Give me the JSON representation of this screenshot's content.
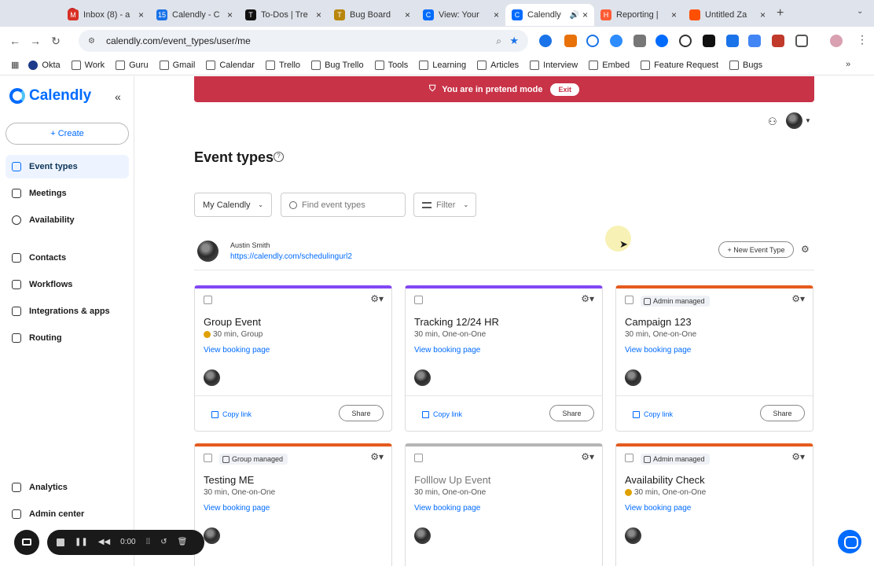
{
  "browser": {
    "tabs": [
      {
        "label": "Inbox (8) - a",
        "fav_color": "#d93025",
        "fav_glyph": "M"
      },
      {
        "label": "Calendly - C",
        "fav_color": "#1a73e8",
        "fav_glyph": "15"
      },
      {
        "label": "To-Dos | Tre",
        "fav_color": "#111111",
        "fav_glyph": "T"
      },
      {
        "label": "Bug Board",
        "fav_color": "#b8860b",
        "fav_glyph": "T"
      },
      {
        "label": "View: Your",
        "fav_color": "#006bff",
        "fav_glyph": "C"
      },
      {
        "label": "Calendly",
        "fav_color": "#006bff",
        "fav_glyph": "C"
      },
      {
        "label": "Reporting |",
        "fav_color": "#ff5c35",
        "fav_glyph": "H"
      },
      {
        "label": "Untitled Za",
        "fav_color": "#ff4f00",
        "fav_glyph": ""
      }
    ],
    "url": "calendly.com/event_types/user/me",
    "bookmarks": [
      "Okta",
      "Work",
      "Guru",
      "Gmail",
      "Calendar",
      "Trello",
      "Bug Trello",
      "Tools",
      "Learning",
      "Articles",
      "Interview",
      "Embed",
      "Feature Request",
      "Bugs"
    ]
  },
  "sidebar": {
    "brand": "Calendly",
    "create": "+ Create",
    "items": [
      "Event types",
      "Meetings",
      "Availability",
      "Contacts",
      "Workflows",
      "Integrations & apps",
      "Routing"
    ],
    "bottom_items": [
      "Analytics",
      "Admin center"
    ]
  },
  "banner": {
    "text": "You are in pretend mode",
    "exit": "Exit"
  },
  "page": {
    "title": "Event types",
    "filter_dropdown": "My Calendly",
    "search_placeholder": "Find event types",
    "filter_label": "Filter",
    "owner_name": "Austin Smith",
    "owner_link": "https://calendly.com/schedulingurl2",
    "new_event_button": "+ New Event Type"
  },
  "cards": [
    {
      "title": "Group Event",
      "meta": "30 min, Group",
      "warn": true,
      "badge": "",
      "color": "#8247f5",
      "link": "View booking page",
      "copy": "Copy link",
      "share": "Share",
      "muted": false
    },
    {
      "title": "Tracking 12/24 HR",
      "meta": "30 min, One-on-One",
      "warn": false,
      "badge": "",
      "color": "#8247f5",
      "link": "View booking page",
      "copy": "Copy link",
      "share": "Share",
      "muted": false
    },
    {
      "title": "Campaign 123",
      "meta": "30 min, One-on-One",
      "warn": false,
      "badge": "Admin managed",
      "color": "#e55b1f",
      "link": "View booking page",
      "copy": "Copy link",
      "share": "Share",
      "muted": false
    },
    {
      "title": "Testing ME",
      "meta": "30 min, One-on-One",
      "warn": false,
      "badge": "Group managed",
      "color": "#e55b1f",
      "link": "View booking page",
      "copy": "",
      "share": "",
      "muted": false
    },
    {
      "title": "Folllow Up Event",
      "meta": "30 min, One-on-One",
      "warn": false,
      "badge": "",
      "color": "#b5b5b5",
      "link": "View booking page",
      "copy": "",
      "share": "",
      "muted": true
    },
    {
      "title": "Availability Check",
      "meta": "30 min, One-on-One",
      "warn": true,
      "badge": "Admin managed",
      "color": "#e55b1f",
      "link": "View booking page",
      "copy": "",
      "share": "",
      "muted": false
    }
  ],
  "recorder": {
    "time": "0:00"
  }
}
